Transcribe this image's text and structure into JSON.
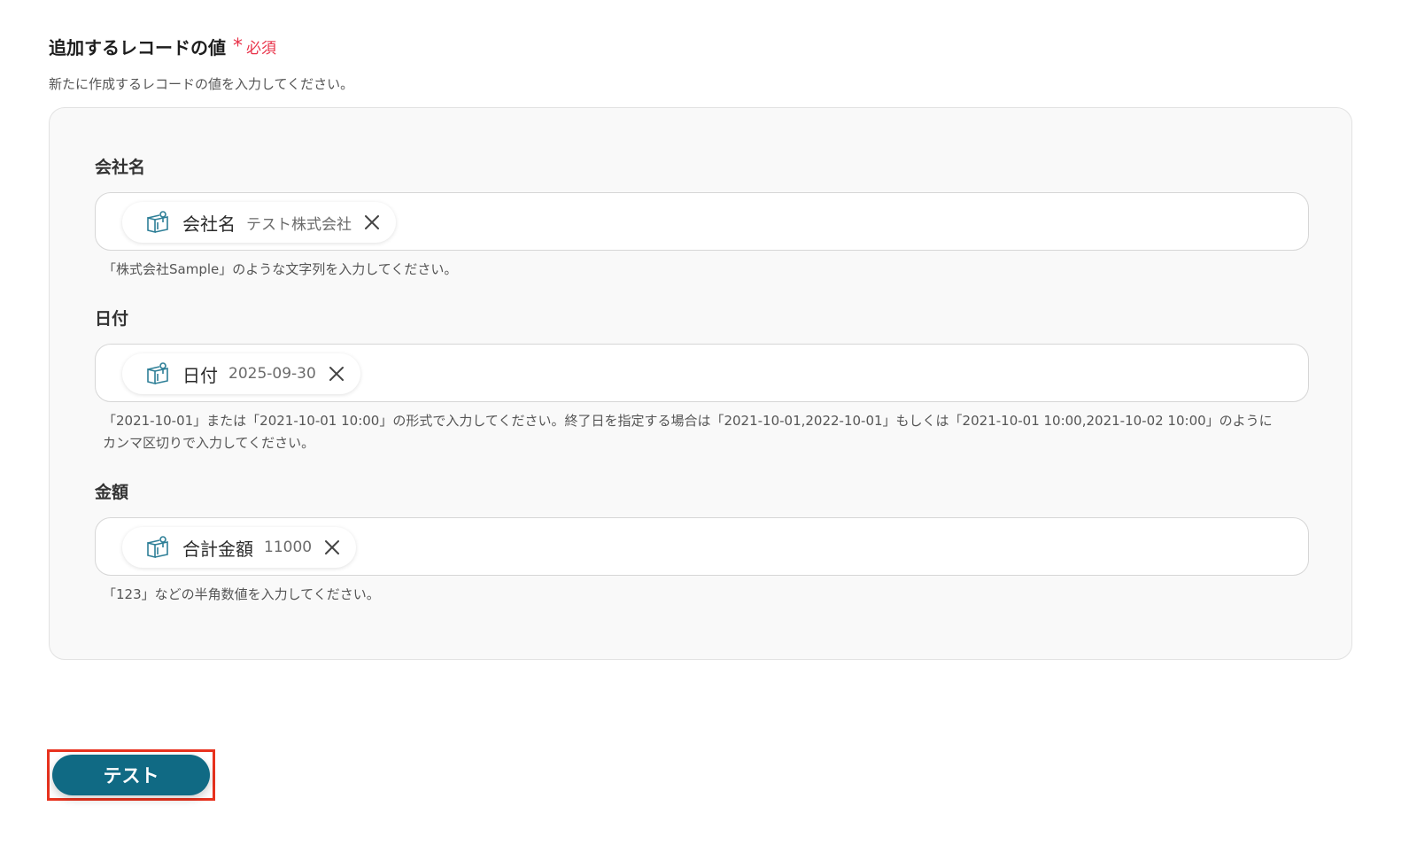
{
  "section": {
    "title": "追加するレコードの値",
    "required_mark": "*",
    "required_label": "必須",
    "description": "新たに作成するレコードの値を入力してください。"
  },
  "fields": [
    {
      "label": "会社名",
      "chip_name": "会社名",
      "chip_value": "テスト株式会社",
      "hint": "「株式会社Sample」のような文字列を入力してください。"
    },
    {
      "label": "日付",
      "chip_name": "日付",
      "chip_value": "2025-09-30",
      "hint": "「2021-10-01」または「2021-10-01 10:00」の形式で入力してください。終了日を指定する場合は「2021-10-01,2022-10-01」もしくは「2021-10-01 10:00,2021-10-02 10:00」のようにカンマ区切りで入力してください。"
    },
    {
      "label": "金額",
      "chip_name": "合計金額",
      "chip_value": "11000",
      "hint": "「123」などの半角数値を入力してください。"
    }
  ],
  "actions": {
    "test_label": "テスト"
  },
  "colors": {
    "accent": "#106a84",
    "required": "#e8334a",
    "highlight": "#e8321e",
    "chip_icon": "#2e7f97"
  },
  "icons": {
    "chip": "book-icon",
    "remove": "close-icon"
  }
}
